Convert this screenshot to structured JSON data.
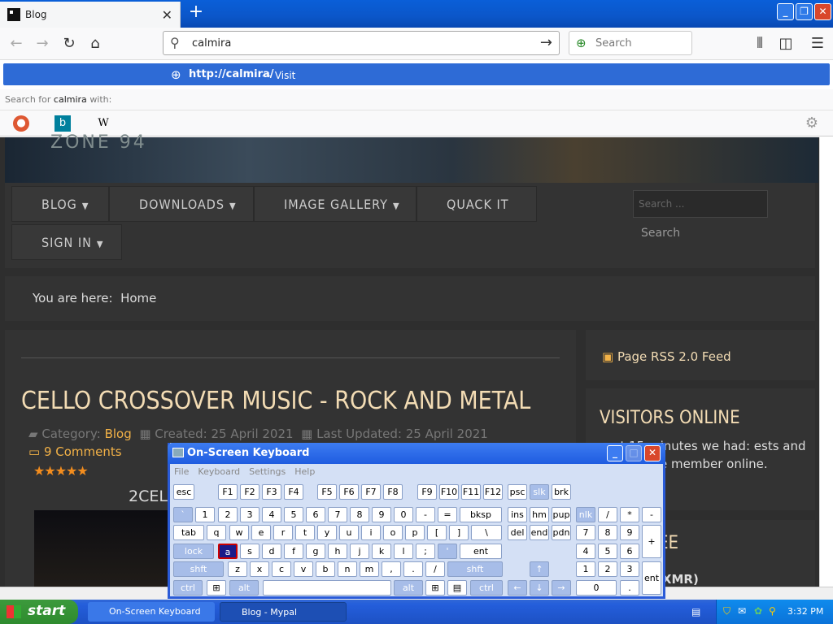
{
  "browser": {
    "tab_title": "Blog",
    "address": "calmira",
    "search_placeholder": "Search"
  },
  "suggestion": {
    "url": "http://calmira/",
    "visit": "— Visit"
  },
  "searchfor": {
    "prefix": "Search for",
    "term": "calmira",
    "suffix": "with:"
  },
  "site": {
    "menu": [
      "BLOG",
      "DOWNLOADS",
      "IMAGE GALLERY",
      "QUACK IT",
      "SIGN IN"
    ],
    "search_placeholder": "Search ...",
    "search_button": "Search",
    "breadcrumb_label": "You are here:",
    "breadcrumb_home": "Home",
    "article_title": "CELLO CROSSOVER MUSIC - ROCK AND METAL",
    "category_label": "Category:",
    "category": "Blog",
    "created": "Created: 25 April 2021",
    "updated": "Last Updated: 25 April 2021",
    "comments": "9 Comments",
    "subhead": "2CELL",
    "rss": "Page RSS 2.0 Feed",
    "visitors_title": "VISITORS ONLINE",
    "visitors_text": "ast 15 minutes we had: ests and one member online.",
    "coffee_title": "A COFFEE",
    "coffee_sub": "ONERO (XMR)"
  },
  "osk": {
    "title": "On-Screen Keyboard",
    "menu": [
      "File",
      "Keyboard",
      "Settings",
      "Help"
    ],
    "selected_key": "a"
  },
  "taskbar": {
    "start": "start",
    "task1": "On-Screen Keyboard",
    "task2": "Blog - Mypal",
    "clock": "3:32 PM"
  }
}
